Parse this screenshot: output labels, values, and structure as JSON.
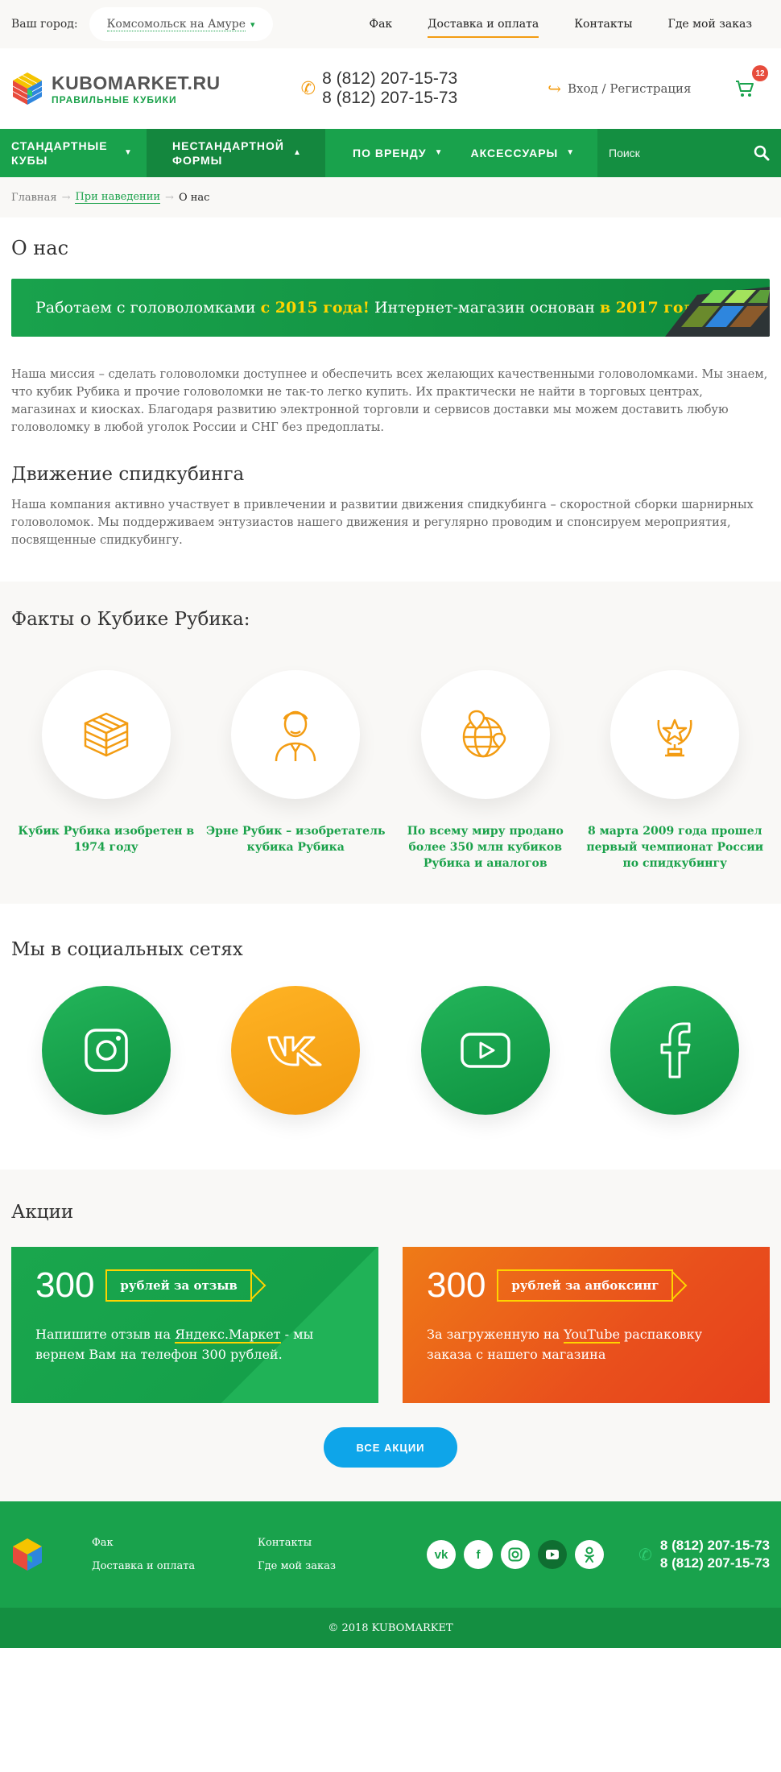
{
  "topbar": {
    "city_label": "Ваш город:",
    "city_value": "Комсомольск на Амуре",
    "links": [
      "Фак",
      "Доставка и оплата",
      "Контакты",
      "Где мой заказ"
    ],
    "active_index": 1
  },
  "header": {
    "logo_title": "KUBOMARKET.RU",
    "logo_sub": "ПРАВИЛЬНЫЕ КУБИКИ",
    "phone1": "8 (812) 207-15-73",
    "phone2": "8 (812) 207-15-73",
    "login": "Вход / Регистрация",
    "cart_count": "12"
  },
  "nav": {
    "items": [
      "СТАНДАРТНЫЕ КУБЫ",
      "НЕСТАНДАРТНОЙ ФОРМЫ",
      "ПО ВРЕНДУ",
      "АКСЕССУАРЫ"
    ],
    "search_placeholder": "Поиск"
  },
  "breadcrumb": {
    "home": "Главная",
    "parent": "При наведении",
    "current": "О нас",
    "sep": "→"
  },
  "page": {
    "title": "О нас",
    "banner_a": "Работаем с головоломками ",
    "banner_b": "с 2015 года!",
    "banner_c": " Интернет-магазин основан ",
    "banner_d": "в 2017 году!",
    "mission": "Наша миссия – сделать головоломки доступнее и обеспечить всех желающих качественными головоломками. Мы знаем, что кубик Рубика и прочие головоломки не так-то легко купить. Их практически не найти в торговых центрах, магазинах и киосках. Благодаря развитию электронной торговли и сервисов доставки мы можем доставить любую головоломку в любой уголок России и СНГ без предоплаты.",
    "movement_title": "Движение спидкубинга",
    "movement_text": "Наша компания активно участвует в привлечении и развитии движения спидкубинга – скоростной сборки шарнирных головоломок. Мы поддерживаем энтузиастов нашего движения и регулярно проводим и спонсируем мероприятия, посвященные спидкубингу."
  },
  "facts": {
    "title": "Факты о Кубике Рубика:",
    "items": [
      {
        "icon": "cube-icon",
        "text": "Кубик Рубика изобретен в 1974 году"
      },
      {
        "icon": "person-icon",
        "text": "Эрне Рубик – изобретатель кубика Рубика"
      },
      {
        "icon": "globe-icon",
        "text": "По всему миру продано более 350 млн кубиков Рубика и аналогов"
      },
      {
        "icon": "trophy-icon",
        "text": "8 марта 2009 года прошел первый чемпионат России по спидкубингу"
      }
    ]
  },
  "social": {
    "title": "Мы в социальных сетях",
    "items": [
      "instagram-icon",
      "vk-icon",
      "youtube-icon",
      "facebook-icon"
    ]
  },
  "promos": {
    "title": "Акции",
    "items": [
      {
        "num": "300",
        "tag": "рублей за отзыв",
        "desc_a": "Напишите отзыв на ",
        "desc_link": "Яндекс.Маркет",
        "desc_b": " - мы вернем Вам на телефон 300 рублей."
      },
      {
        "num": "300",
        "tag": "рублей за анбоксинг",
        "desc_a": "За загруженную на ",
        "desc_link": "YouTube",
        "desc_b": " распаковку заказа с нашего магазина"
      }
    ],
    "all_button": "ВСЕ АКЦИИ"
  },
  "footer": {
    "links": [
      "Фак",
      "Контакты",
      "Доставка и оплата",
      "Где мой заказ"
    ],
    "phone1": "8 (812) 207-15-73",
    "phone2": "8 (812) 207-15-73",
    "copyright": "© 2018 KUBOMARKET"
  },
  "colors": {
    "green": "#19a24c",
    "orange": "#f39c12",
    "yellow": "#ffd400",
    "blue": "#0ea5e9"
  }
}
